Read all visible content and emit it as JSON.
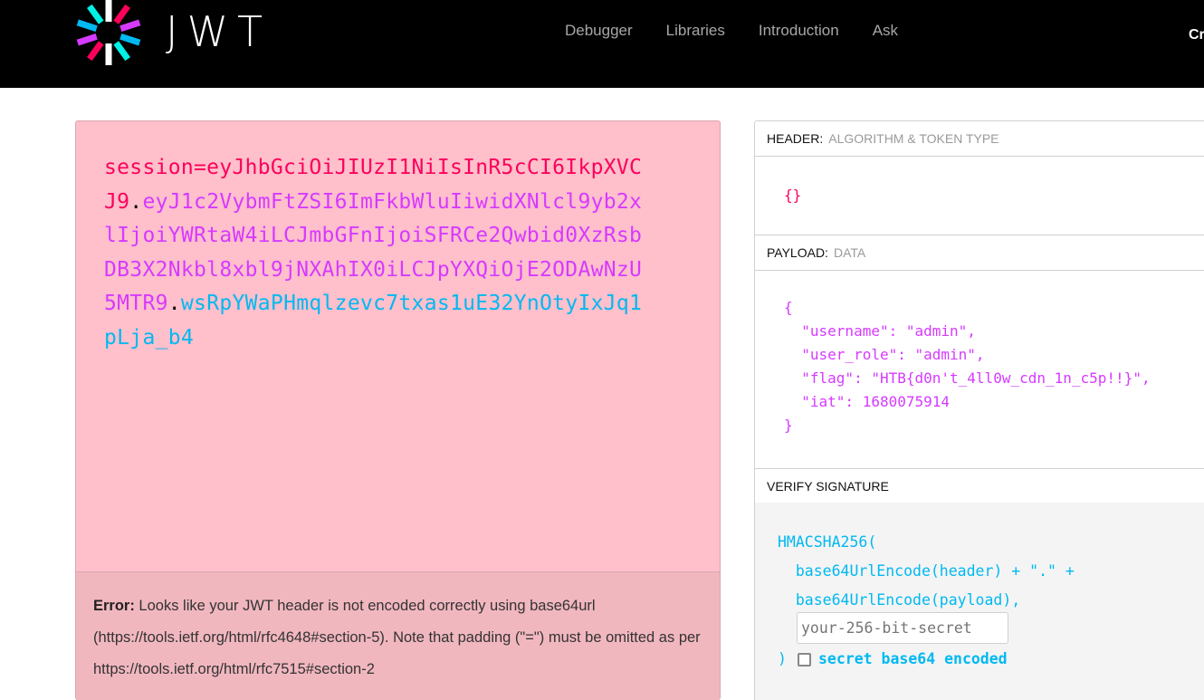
{
  "brand": {
    "name": "JWT",
    "logo_icon": "jwt-pinwheel-logo"
  },
  "nav": {
    "links": [
      "Debugger",
      "Libraries",
      "Introduction",
      "Ask"
    ],
    "cut_off_text": "Cr"
  },
  "encoded": {
    "header_part": "session=eyJhbGciOiJIUzI1NiIsInR5cCI6IkpXVCJ9",
    "dot1": ".",
    "payload_part": "eyJ1c2VybmFtZSI6ImFkbWluIiwidXNlcl9yb2xlIjoiYWRtaW4iLCJmbGFnIjoiSFRCe2Qwbid0XzRsbDB3X2Nkbl8xbl9jNXAhIX0iLCJpYXQiOjE2ODAwNzU5MTR9",
    "dot2": ".",
    "signature_part": "wsRpYWaPHmqlzevc7txas1uE32YnOtyIxJq1pLja_b4",
    "colors": {
      "header": "#fb015b",
      "payload": "#d63aff",
      "signature": "#00b9f1"
    }
  },
  "error": {
    "label": "Error:",
    "message": " Looks like your JWT header is not encoded correctly using base64url (https://tools.ietf.org/html/rfc4648#section-5). Note that padding (\"=\") must be omitted as per https://tools.ietf.org/html/rfc7515#section-2"
  },
  "decoded": {
    "header": {
      "title": "HEADER:",
      "subtitle": "ALGORITHM & TOKEN TYPE",
      "json": "{}"
    },
    "payload": {
      "title": "PAYLOAD:",
      "subtitle": "DATA",
      "json": "{\n  \"username\": \"admin\",\n  \"user_role\": \"admin\",\n  \"flag\": \"HTB{d0n't_4ll0w_cdn_1n_c5p!!}\",\n  \"iat\": 1680075914\n}"
    },
    "signature": {
      "title": "VERIFY SIGNATURE",
      "code": "HMACSHA256(\n  base64UrlEncode(header) + \".\" +\n  base64UrlEncode(payload),",
      "secret_placeholder": "your-256-bit-secret",
      "close_paren": ")",
      "checkbox_label": "secret base64 encoded",
      "checkbox_checked": false
    }
  }
}
